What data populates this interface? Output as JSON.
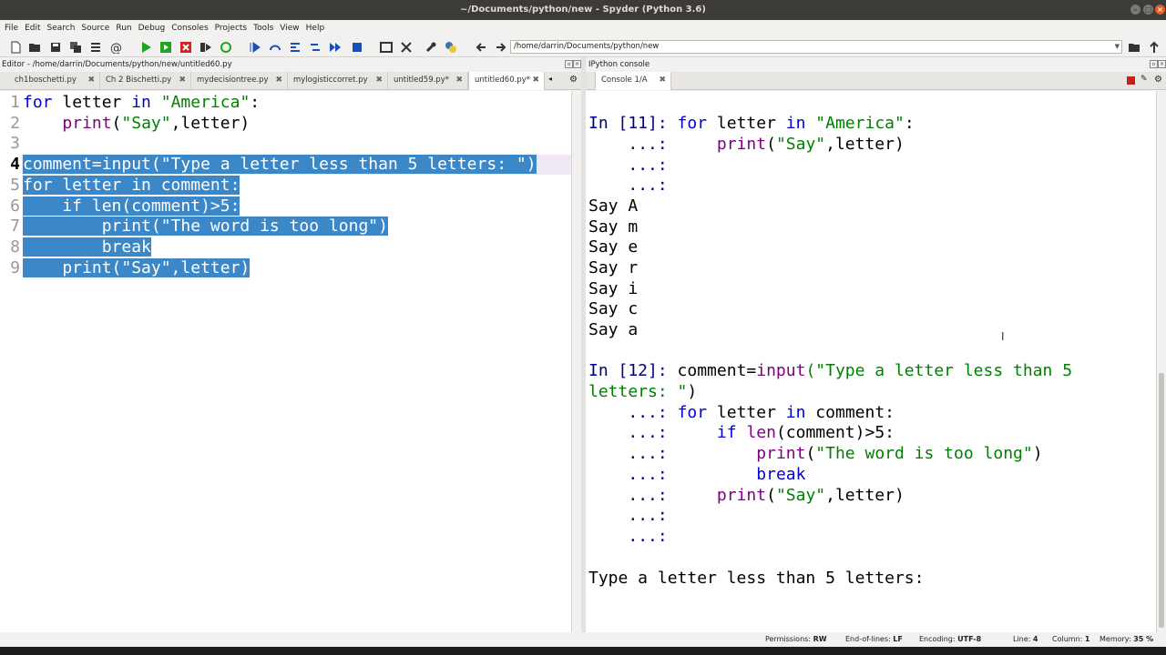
{
  "window": {
    "title": "~/Documents/python/new - Spyder (Python 3.6)"
  },
  "menu": [
    "File",
    "Edit",
    "Search",
    "Source",
    "Run",
    "Debug",
    "Consoles",
    "Projects",
    "Tools",
    "View",
    "Help"
  ],
  "toolbar": {
    "path": "/home/darrin/Documents/python/new"
  },
  "editor": {
    "header": "Editor - /home/darrin/Documents/python/new/untitled60.py",
    "tabs": [
      "ch1boschetti.py",
      "Ch 2 Bischetti.py",
      "mydecisiontree.py",
      "mylogisticcorret.py",
      "untitled59.py*",
      "untitled60.py*"
    ],
    "line_numbers": [
      "1",
      "2",
      "3",
      "4",
      "5",
      "6",
      "7",
      "8",
      "9"
    ],
    "code": {
      "l1_kw1": "for",
      "l1_mid": " letter ",
      "l1_kw2": "in",
      "l1_str": "\"America\"",
      "l1_end": ":",
      "l2_indent": "    ",
      "l2_fn": "print",
      "l2_str": "\"Say\"",
      "l2_rest": ",letter)",
      "l4_pre": "comment=",
      "l4_fn": "input",
      "l4_open": "(",
      "l4_str": "\"Type a letter less than 5 letters: \"",
      "l4_close": ")",
      "l5": "for letter in comment:",
      "l6": "    if len(comment)>5:",
      "l7": "        print(\"The word is too long\")",
      "l8": "        break",
      "l9": "    print(\"Say\",letter)"
    }
  },
  "console": {
    "header": "IPython console",
    "tab": "Console 1/A",
    "in11_prompt": "In [11]:",
    "in11_code_kw": "for",
    "in11_code_mid": " letter ",
    "in11_code_kw2": "in",
    "in11_code_str": "\"America\"",
    "in11_code_end": ":",
    "cont": "...:",
    "in11_l2_fn": "print",
    "in11_l2_open": "(",
    "in11_l2_str": "\"Say\"",
    "in11_l2_rest": ",letter)",
    "outputs": [
      "Say A",
      "Say m",
      "Say e",
      "Say r",
      "Say i",
      "Say c",
      "Say a"
    ],
    "in12_prompt": "In [12]:",
    "in12_pre": "comment=",
    "in12_fn": "input",
    "in12_str_a": "(\"Type a letter less than 5",
    "in12_str_b": "letters: \"",
    "in12_close": ")",
    "in12_l3_kw": "for",
    "in12_l3_mid": " letter ",
    "in12_l3_kw2": "in",
    "in12_l3_end": " comment:",
    "in12_l4_kw": "if",
    "in12_l4_fn": "len",
    "in12_l4_rest": "(comment)>5:",
    "in12_l5_fn": "print",
    "in12_l5_open": "(",
    "in12_l5_str": "\"The word is too long\"",
    "in12_l5_close": ")",
    "in12_l6_kw": "break",
    "in12_l7_fn": "print",
    "in12_l7_open": "(",
    "in12_l7_str": "\"Say\"",
    "in12_l7_rest": ",letter)",
    "input_prompt": "Type a letter less than 5 letters:"
  },
  "status": {
    "permissions_label": "Permissions:",
    "permissions": "RW",
    "eol_label": "End-of-lines:",
    "eol": "LF",
    "encoding_label": "Encoding:",
    "encoding": "UTF-8",
    "line_label": "Line:",
    "line": "4",
    "column_label": "Column:",
    "column": "1",
    "memory_label": "Memory:",
    "memory": "35 %"
  },
  "colors": {
    "selection": "#3b87c7",
    "keyword": "#0000d0",
    "builtin": "#800080",
    "string": "#008000",
    "prompt": "#000080"
  }
}
